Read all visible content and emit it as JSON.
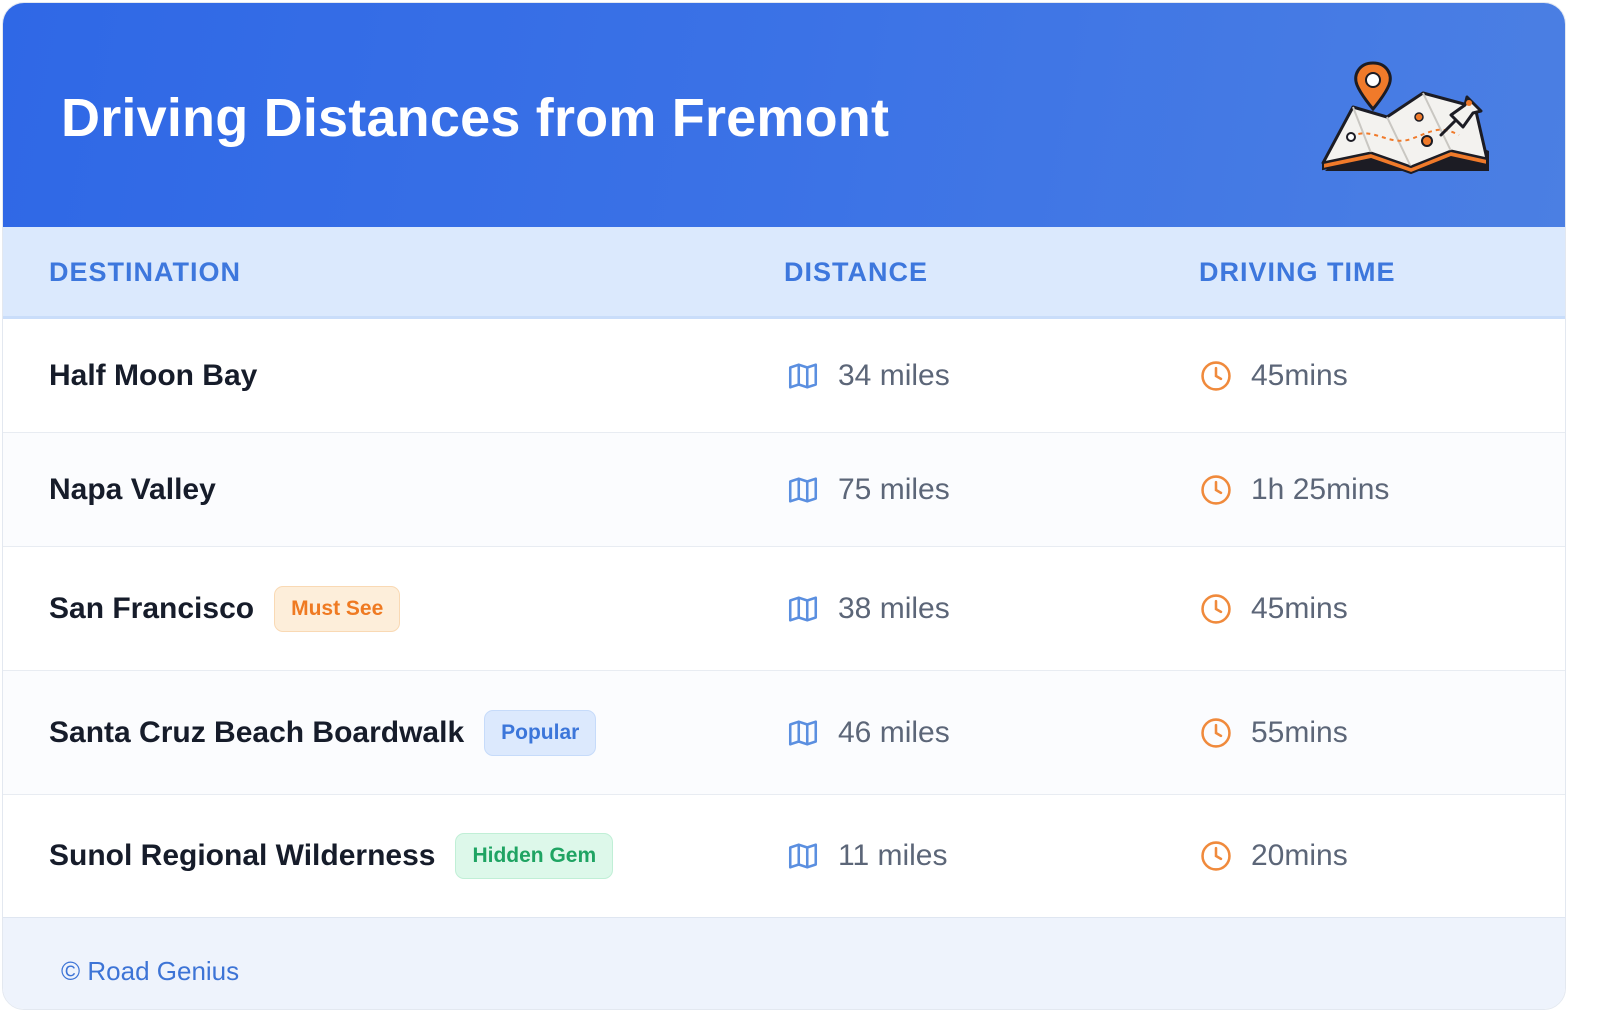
{
  "header": {
    "title": "Driving Distances from Fremont",
    "illustration": "map-with-pins-icon",
    "gradient": [
      "#2f68e6",
      "#4b7fe3"
    ]
  },
  "table": {
    "columns": [
      "DESTINATION",
      "DISTANCE",
      "DRIVING TIME"
    ],
    "rows": [
      {
        "destination": "Half Moon Bay",
        "badge": "",
        "badge_color": "",
        "distance": "34 miles",
        "time": "45mins"
      },
      {
        "destination": "Napa Valley",
        "badge": "",
        "badge_color": "",
        "distance": "75 miles",
        "time": "1h 25mins"
      },
      {
        "destination": "San Francisco",
        "badge": "Must See",
        "badge_color": "orange",
        "distance": "38 miles",
        "time": "45mins"
      },
      {
        "destination": "Santa Cruz Beach Boardwalk",
        "badge": "Popular",
        "badge_color": "blue",
        "distance": "46 miles",
        "time": "55mins"
      },
      {
        "destination": "Sunol Regional Wilderness",
        "badge": "Hidden Gem",
        "badge_color": "green",
        "distance": "11 miles",
        "time": "20mins"
      }
    ],
    "icons": {
      "distance": "map-icon",
      "time": "clock-icon"
    }
  },
  "footer": {
    "text": "© Road Genius"
  },
  "colors": {
    "accent": "#3d77dd",
    "map_icon": "#5b8fe0",
    "clock_icon": "#f08a3c",
    "badge_orange": "#ef7a22",
    "badge_blue": "#3c76da",
    "badge_green": "#1fa463"
  }
}
